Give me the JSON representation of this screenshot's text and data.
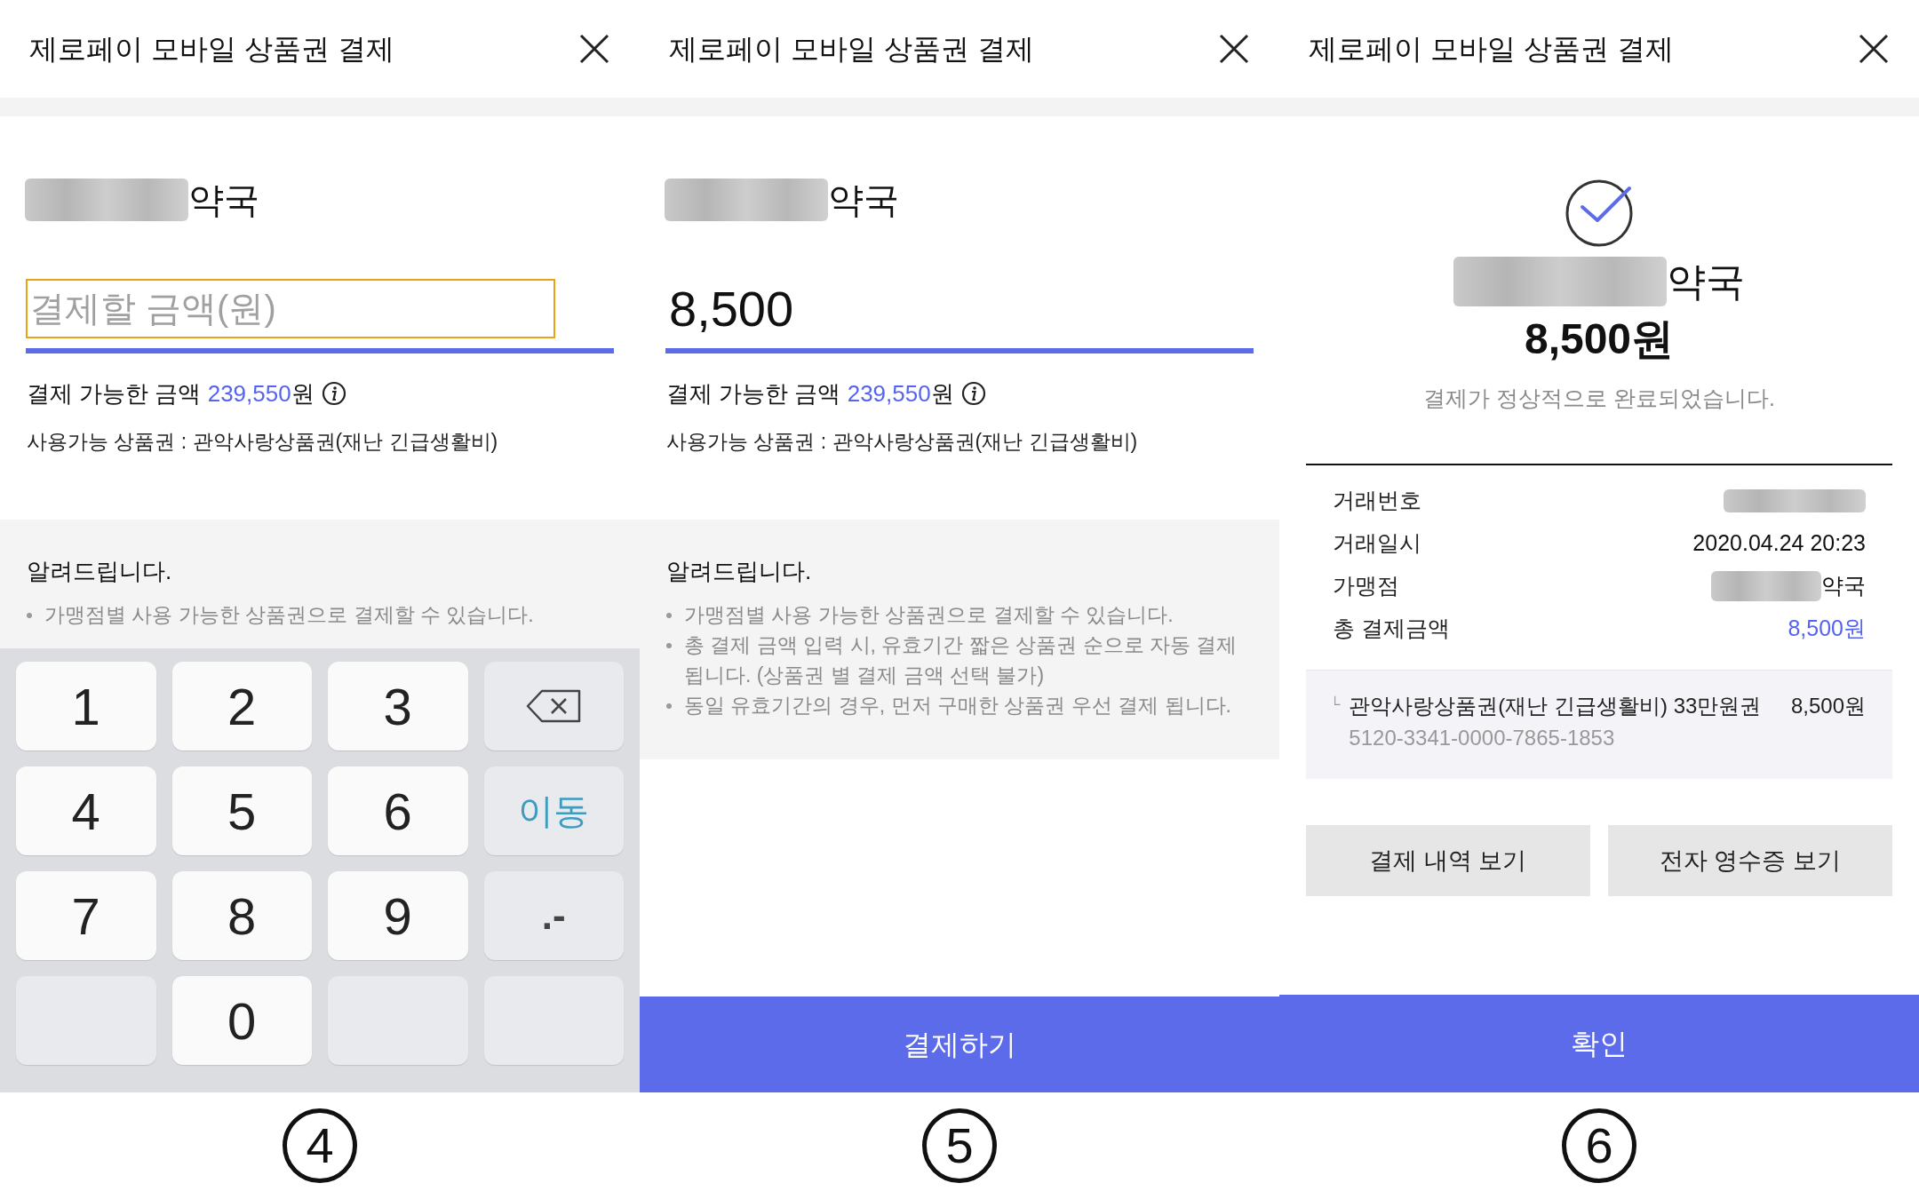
{
  "panels": [
    {
      "kind": "entry",
      "title": "제로페이 모바일 상품권 결제",
      "merchant_suffix": "약국",
      "amount_field": {
        "placeholder": "결제할 금액(원)",
        "focused": true
      },
      "available": {
        "label": "결제 가능한 금액",
        "amount": "239,550",
        "unit": "원"
      },
      "vouchers": "사용가능 상품권 : 관악사랑상품권(재난 긴급생활비)",
      "notice": {
        "title": "알려드립니다.",
        "items": [
          "가맹점별 사용 가능한 상품권으로 결제할 수 있습니다."
        ]
      },
      "keypad": [
        {
          "kind": "digit",
          "label": "1"
        },
        {
          "kind": "digit",
          "label": "2"
        },
        {
          "kind": "digit",
          "label": "3"
        },
        {
          "kind": "backspace"
        },
        {
          "kind": "digit",
          "label": "4"
        },
        {
          "kind": "digit",
          "label": "5"
        },
        {
          "kind": "digit",
          "label": "6"
        },
        {
          "kind": "action",
          "label": "이동"
        },
        {
          "kind": "digit",
          "label": "7"
        },
        {
          "kind": "digit",
          "label": "8"
        },
        {
          "kind": "digit",
          "label": "9"
        },
        {
          "kind": "symbol",
          "label": ".-"
        },
        {
          "kind": "blank"
        },
        {
          "kind": "digit",
          "label": "0"
        },
        {
          "kind": "blank"
        },
        {
          "kind": "blank"
        }
      ],
      "step": "4"
    },
    {
      "kind": "entry",
      "title": "제로페이 모바일 상품권 결제",
      "merchant_suffix": "약국",
      "amount_field": {
        "value": "8,500",
        "focused": false
      },
      "available": {
        "label": "결제 가능한 금액",
        "amount": "239,550",
        "unit": "원"
      },
      "vouchers": "사용가능 상품권 : 관악사랑상품권(재난 긴급생활비)",
      "notice": {
        "title": "알려드립니다.",
        "items": [
          "가맹점별 사용 가능한 상품권으로 결제할 수 있습니다.",
          "총 결제 금액 입력 시, 유효기간 짧은 상품권 순으로 자동 결제 됩니다. (상품권 별 결제 금액 선택 불가)",
          "동일 유효기간의 경우, 먼저 구매한 상품권 우선 결제 됩니다."
        ]
      },
      "submit": "결제하기",
      "step": "5"
    },
    {
      "kind": "receipt",
      "title": "제로페이 모바일 상품권 결제",
      "merchant_suffix": "약국",
      "amount": "8,500원",
      "message": "결제가 정상적으로 완료되었습니다.",
      "details": [
        {
          "kind": "masked",
          "label": "거래번호"
        },
        {
          "kind": "text",
          "label": "거래일시",
          "value": "2020.04.24 20:23"
        },
        {
          "kind": "merchant",
          "label": "가맹점",
          "value": "약국"
        },
        {
          "kind": "total",
          "label": "총 결제금액",
          "value": "8,500원"
        }
      ],
      "voucher": {
        "marker": "└",
        "name": "관악사랑상품권(재난 긴급생활비) 33만원권",
        "amount": "8,500원",
        "number": "5120-3341-0000-7865-1853"
      },
      "buttons": [
        "결제 내역 보기",
        "전자 영수증 보기"
      ],
      "confirm": "확인",
      "step": "6"
    }
  ]
}
